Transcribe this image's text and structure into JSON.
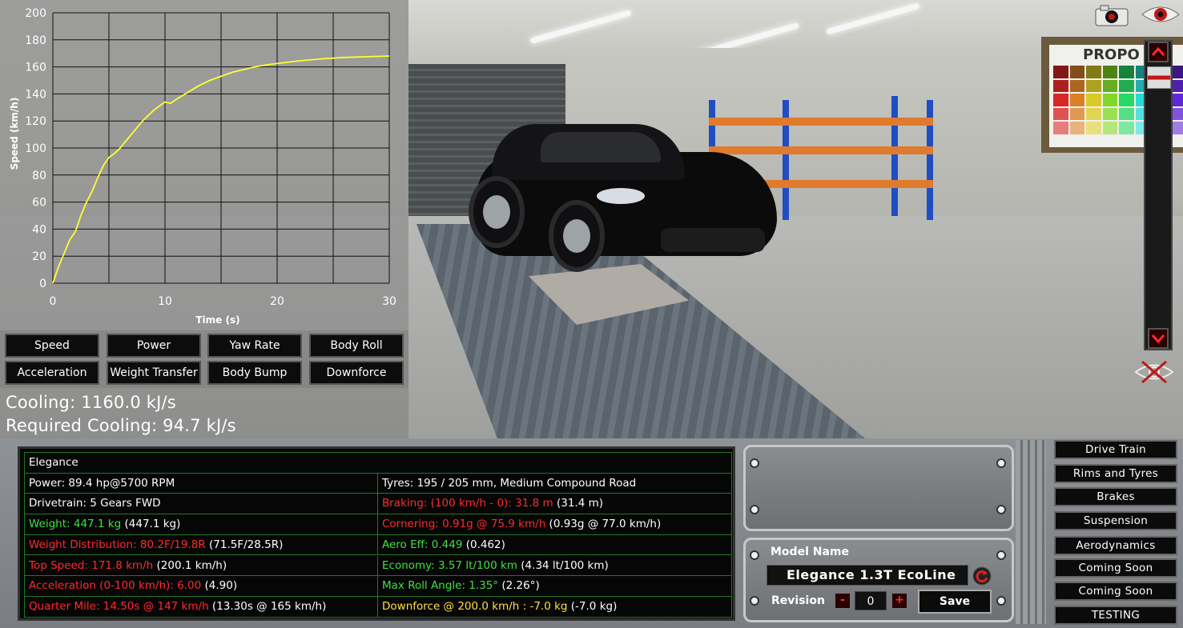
{
  "chart": {
    "ylabel": "Speed (km/h)",
    "xlabel": "Time (s)",
    "line_color": "#ffff33"
  },
  "chart_data": {
    "type": "line",
    "xlabel": "Time (s)",
    "ylabel": "Speed (km/h)",
    "xlim": [
      0,
      30
    ],
    "ylim": [
      0,
      200
    ],
    "x_ticks": [
      0,
      10,
      20,
      30
    ],
    "y_ticks": [
      0,
      20,
      40,
      60,
      80,
      100,
      120,
      140,
      160,
      180,
      200
    ],
    "grid": true,
    "series": [
      {
        "x": [
          0,
          0.5,
          1,
          1.5,
          2,
          2.5,
          3,
          3.5,
          4,
          4.5,
          5,
          5.5,
          6,
          7,
          8,
          9,
          10,
          10.5,
          11,
          12,
          13,
          14,
          15,
          16,
          17,
          18,
          19,
          20,
          22,
          24,
          26,
          28,
          30
        ],
        "y": [
          0,
          12,
          22,
          32,
          38,
          50,
          60,
          68,
          78,
          87,
          93,
          96,
          100,
          110,
          120,
          128,
          134,
          133,
          136,
          141,
          146,
          150,
          153,
          156,
          158,
          160,
          161.5,
          162.5,
          164.5,
          166,
          167,
          167.5,
          168
        ]
      }
    ]
  },
  "graph_buttons": [
    "Speed",
    "Power",
    "Yaw Rate",
    "Body Roll",
    "Acceleration",
    "Weight Transfer",
    "Body Bump",
    "Downforce"
  ],
  "cooling": {
    "line1": "Cooling: 1160.0 kJ/s",
    "line2": "Required Cooling: 94.7 kJ/s"
  },
  "stats": {
    "title": "Elegance",
    "rows": [
      {
        "left": [
          {
            "t": "Power: 89.4 hp@5700 RPM",
            "c": "white"
          }
        ],
        "right": [
          {
            "t": "Tyres: 195 / 205 mm, Medium Compound Road",
            "c": "white"
          }
        ]
      },
      {
        "left": [
          {
            "t": "Drivetrain: 5 Gears FWD",
            "c": "white"
          }
        ],
        "right": [
          {
            "t": "Braking: (100 km/h - 0): 31.8 m",
            "c": "red"
          },
          {
            "t": " (31.4 m)",
            "c": "white"
          }
        ]
      },
      {
        "left": [
          {
            "t": "Weight: 447.1 kg",
            "c": "green"
          },
          {
            "t": " (447.1 kg)",
            "c": "white"
          }
        ],
        "right": [
          {
            "t": "Cornering: 0.91g @ 75.9 km/h",
            "c": "red"
          },
          {
            "t": " (0.93g @ 77.0 km/h)",
            "c": "white"
          }
        ]
      },
      {
        "left": [
          {
            "t": "Weight Distribution: 80.2F/19.8R",
            "c": "red"
          },
          {
            "t": " (71.5F/28.5R)",
            "c": "white"
          }
        ],
        "right": [
          {
            "t": "Aero Eff: 0.449",
            "c": "green"
          },
          {
            "t": " (0.462)",
            "c": "white"
          }
        ]
      },
      {
        "left": [
          {
            "t": "Top Speed: 171.8 km/h",
            "c": "red"
          },
          {
            "t": " (200.1 km/h)",
            "c": "white"
          }
        ],
        "right": [
          {
            "t": "Economy: 3.57 lt/100 km",
            "c": "green"
          },
          {
            "t": " (4.34 lt/100 km)",
            "c": "white"
          }
        ]
      },
      {
        "left": [
          {
            "t": "Acceleration (0-100 km/h): 6.00",
            "c": "red"
          },
          {
            "t": " (4.90)",
            "c": "white"
          }
        ],
        "right": [
          {
            "t": "Max Roll Angle: 1.35°",
            "c": "green"
          },
          {
            "t": " (2.26°)",
            "c": "white"
          }
        ]
      },
      {
        "left": [
          {
            "t": "Quarter Mile: 14.50s @ 147 km/h",
            "c": "red"
          },
          {
            "t": " (13.30s @ 165 km/h)",
            "c": "white"
          }
        ],
        "right": [
          {
            "t": "Downforce @ 200.0 km/h : -7.0 kg",
            "c": "yellow"
          },
          {
            "t": " (-7.0 kg)",
            "c": "white"
          }
        ]
      }
    ]
  },
  "model": {
    "name_label": "Model Name",
    "name_value": "Elegance  1.3T  EcoLine",
    "revision_label": "Revision",
    "revision_value": "0",
    "minus": "-",
    "plus": "+",
    "save_label": "Save"
  },
  "nav": [
    "Drive Train",
    "Rims and Tyres",
    "Brakes",
    "Suspension",
    "Aerodynamics",
    "Coming Soon",
    "Coming Soon",
    "TESTING"
  ],
  "poster_title": "PROPO",
  "colors": {
    "red_stat": "#ff2a2a",
    "green_stat": "#3ee03e",
    "yellow_stat": "#ffe040",
    "grid_green": "#1e7a1e"
  }
}
